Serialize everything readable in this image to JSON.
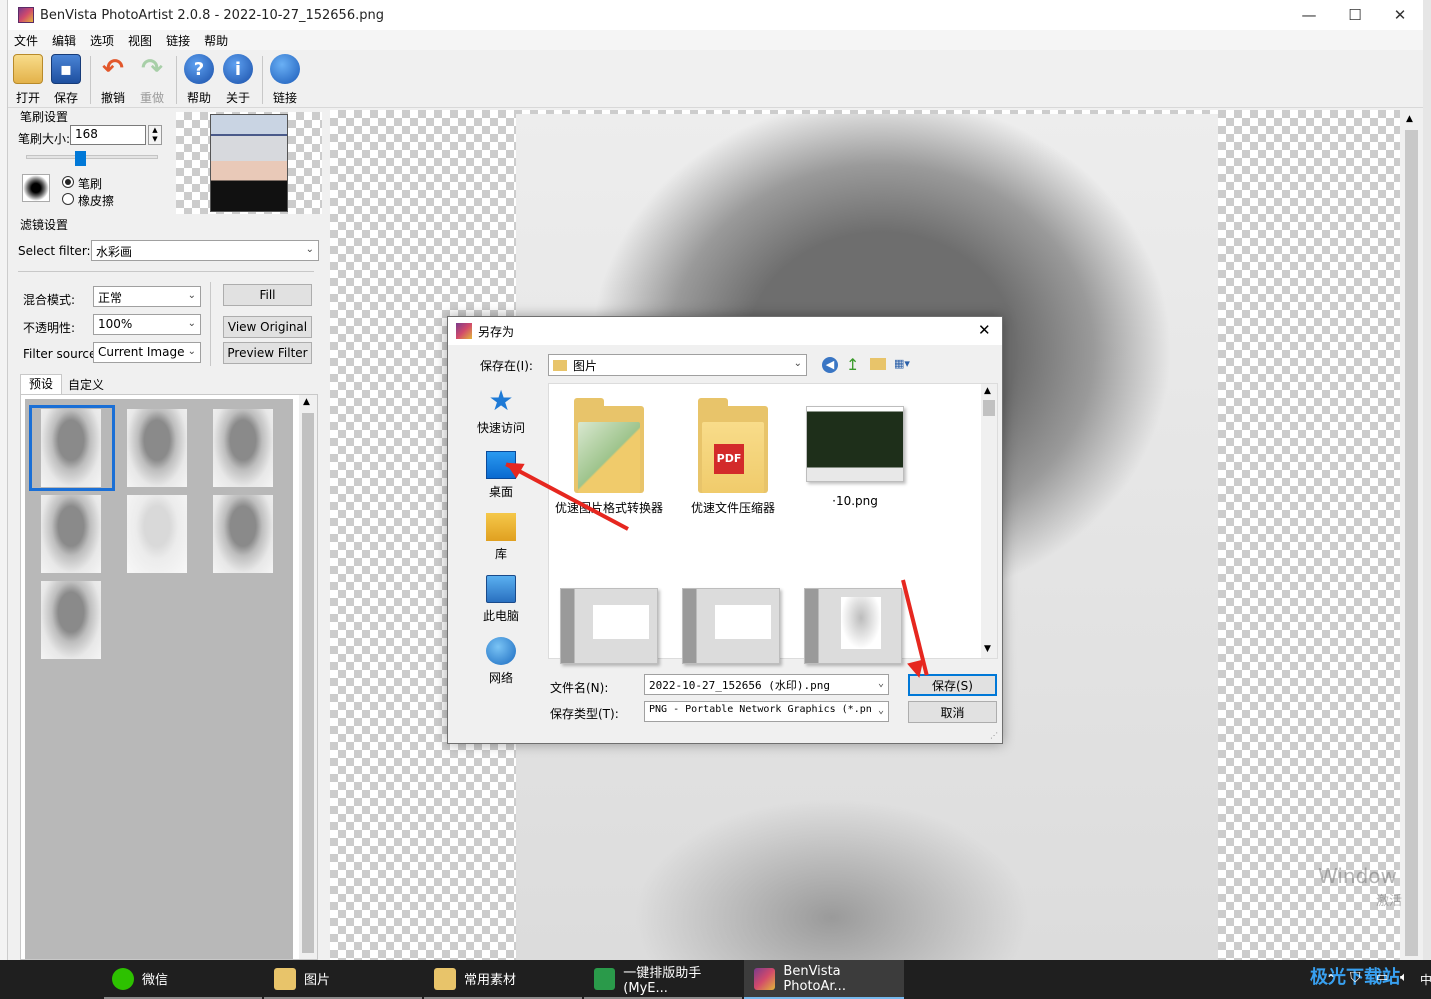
{
  "window": {
    "title": "BenVista PhotoArtist 2.0.8 - 2022-10-27_152656.png",
    "minimize_glyph": "—",
    "maximize_glyph": "☐",
    "close_glyph": "✕"
  },
  "menu": [
    "文件",
    "编辑",
    "选项",
    "视图",
    "链接",
    "帮助"
  ],
  "toolbar": {
    "open": "打开",
    "save": "保存",
    "undo": "撤销",
    "redo": "重做",
    "help": "帮助",
    "about": "关于",
    "link": "链接"
  },
  "brush": {
    "group": "笔刷设置",
    "size_label": "笔刷大小:",
    "size_value": "168",
    "size_fraction": 0.4,
    "mode_brush": "笔刷",
    "mode_eraser": "橡皮擦",
    "selected_mode": "笔刷"
  },
  "filter": {
    "group": "滤镜设置",
    "select_label": "Select filter:",
    "select_value": "水彩画",
    "blend_label": "混合模式:",
    "blend_value": "正常",
    "opacity_label": "不透明性:",
    "opacity_value": "100%",
    "source_label": "Filter source:",
    "source_value": "Current Image",
    "fill_button": "Fill",
    "view_original_button": "View Original",
    "preview_button": "Preview Filter",
    "tab_presets": "预设",
    "tab_custom": "自定义"
  },
  "dialog": {
    "title": "另存为",
    "save_in_label": "保存在(I):",
    "save_in_value": "图片",
    "places": [
      "快速访问",
      "桌面",
      "库",
      "此电脑",
      "网络"
    ],
    "files": [
      {
        "name": "优速图片格式转换器",
        "kind": "folder"
      },
      {
        "name": "优速文件压缩器",
        "kind": "folder"
      },
      {
        "name": "·10.png",
        "kind": "image"
      },
      {
        "name": "",
        "kind": "image"
      },
      {
        "name": "",
        "kind": "image"
      },
      {
        "name": "",
        "kind": "image"
      }
    ],
    "pdf_label": "PDF",
    "filename_label": "文件名(N):",
    "filename_value": "2022-10-27_152656 (水印).png",
    "filetype_label": "保存类型(T):",
    "filetype_value": "PNG - Portable Network Graphics (*.pn",
    "save_button": "保存(S)",
    "cancel_button": "取消"
  },
  "taskbar": {
    "items": [
      "微信",
      "图片",
      "常用素材",
      "一键排版助手(MyE...",
      "BenVista PhotoAr..."
    ],
    "tray_ime": "中"
  },
  "watermark": {
    "win_line1": "Window",
    "win_line2": "激活",
    "site": "极光下载站"
  },
  "colors": {
    "accent": "#0078d7",
    "arrow": "#e6271f",
    "taskbar": "#1f1f1f"
  }
}
